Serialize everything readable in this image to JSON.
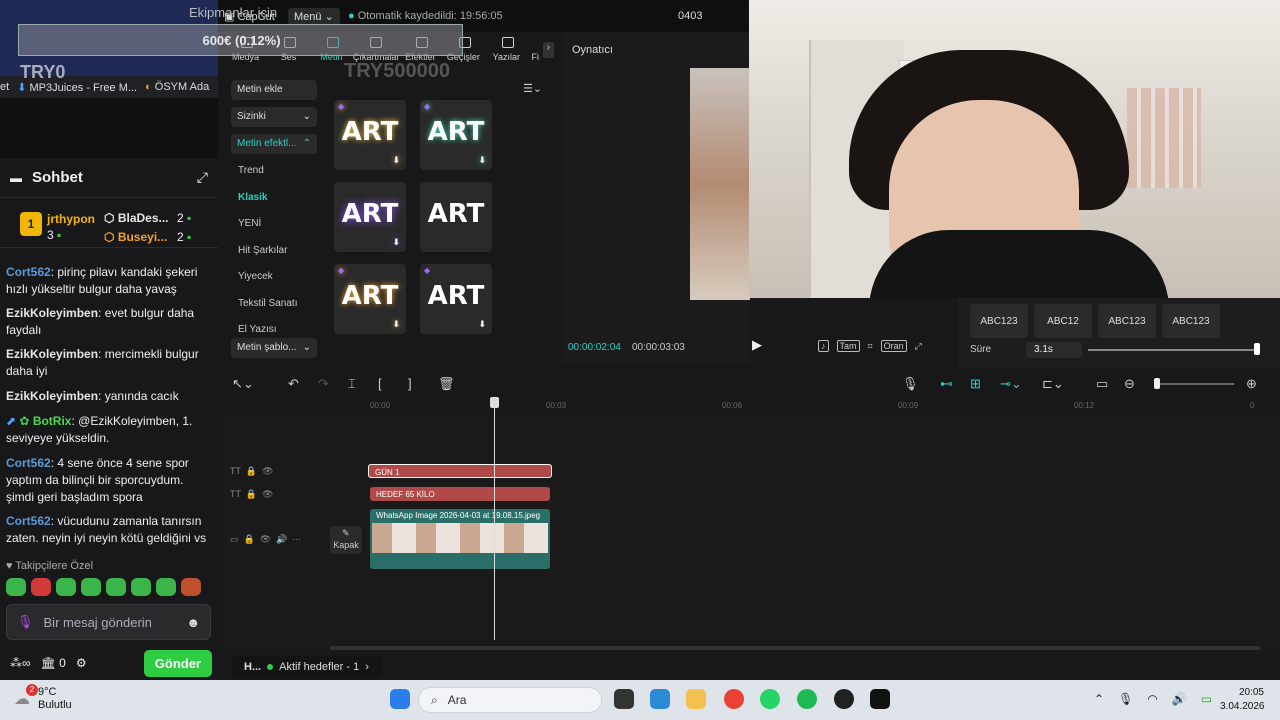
{
  "banner": {
    "subtitle": "Ekipmanlar için",
    "amount": "600€ (0.12%)",
    "try_label": "TRY0"
  },
  "bookmarks": [
    "et",
    "MP3Juices - Free M...",
    "ÖSYM Ada"
  ],
  "chat": {
    "title": "Sohbet",
    "leaders": [
      {
        "rank": "1",
        "name": "jrthypon",
        "count": "3"
      },
      {
        "name": "BlaDes...",
        "count": "2"
      },
      {
        "name": "Buseyi...",
        "count": "2"
      }
    ],
    "messages": [
      {
        "user": "Cort562",
        "text": ": pirinç pilavı kandaki şekeri hızlı yükseltir bulgur daha yavaş"
      },
      {
        "user": "EzikKoleyimben",
        "text": ": evet bulgur daha faydalı"
      },
      {
        "user": "EzikKoleyimben",
        "text": ": mercimekli bulgur daha iyi"
      },
      {
        "user": "EzikKoleyimben",
        "text": ": yanında cacık"
      },
      {
        "user": "BotRix",
        "text": ": @EzikKoleyimben, 1. seviyeye yükseldin."
      },
      {
        "user": "Cort562",
        "text": ": 4 sene önce 4 sene spor yaptım da bilinçli bir sporcuydum. şimdi geri başladım spora"
      },
      {
        "user": "Cort562",
        "text": ": vücudunu zamanla tanırsın zaten. neyin iyi neyin kötü geldiğini vs"
      }
    ],
    "followers_only": "Takipçilere Özel",
    "input_placeholder": "Bir mesaj gönderin",
    "points": "0",
    "send_label": "Gönder"
  },
  "capcut": {
    "app_name": "CapCut",
    "menu": "Menü",
    "autosave": "Otomatik kaydedildi: 19:56:05",
    "project": "0403",
    "tabs": [
      "Medya",
      "Ses",
      "Metin",
      "Çıkartmalar",
      "Efektler",
      "Geçişler",
      "Yazılar",
      "Fi"
    ],
    "active_tab": "Metin",
    "left": {
      "add_text": "Metin ekle",
      "sizinki": "Sizinki",
      "effects": "Metin efektl...",
      "items": [
        "Trend",
        "Klasik",
        "YENİ",
        "Hit Şarkılar",
        "Yiyecek",
        "Tekstil Sanatı",
        "El Yazısı"
      ],
      "active_item": "Klasik",
      "templates": "Metin şablo..."
    },
    "overlay_try": "TRY500000",
    "tiles": [
      "ART",
      "ART",
      "ART",
      "ART",
      "ART",
      "ART"
    ],
    "player": {
      "title": "Oynatıcı",
      "time_current": "00:00:02:04",
      "time_total": "00:00:03:03",
      "full_label": "Tam",
      "ratio_label": "Oran"
    },
    "props": {
      "abc": [
        "ABC123",
        "ABC12",
        "ABC123",
        "ABC123"
      ],
      "duration_label": "Süre",
      "duration_value": "3.1s"
    },
    "ruler": [
      "00:00",
      "00:03",
      "00:06",
      "00:09",
      "00:12",
      "0"
    ],
    "clips": {
      "text1": "GÜN 1",
      "text2": "HEDEF 65 KİLO",
      "video": "WhatsApp Image 2026-04-03 at 19.08.15.jpeg"
    },
    "cover_label": "Kapak"
  },
  "goal": {
    "label": "H...",
    "text": "Aktif hedefler - 1"
  },
  "taskbar": {
    "temp": "9°C",
    "weather": "Bulutlu",
    "badge": "2",
    "search": "Ara",
    "time": "20:05",
    "date": "3.04.2026"
  }
}
